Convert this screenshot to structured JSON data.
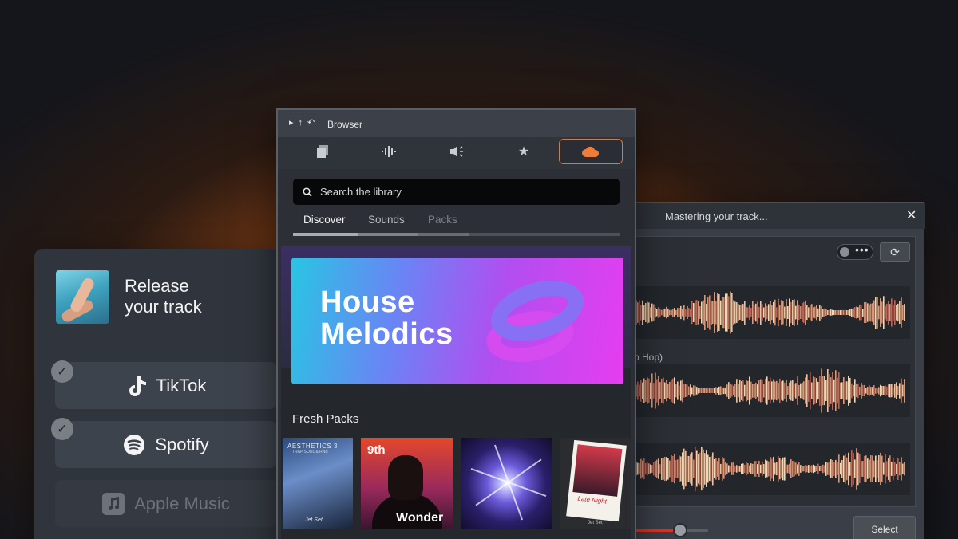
{
  "release": {
    "title_line1": "Release",
    "title_line2": "your track",
    "platforms": [
      {
        "label": "TikTok",
        "checked": true
      },
      {
        "label": "Spotify",
        "checked": true
      },
      {
        "label": "Apple Music",
        "checked": false
      }
    ]
  },
  "browser": {
    "title": "Browser",
    "toolbar_icons": [
      "files-icon",
      "waveform-icon",
      "speaker-icon",
      "star-icon",
      "cloud-icon"
    ],
    "active_toolbar_icon": "cloud-icon",
    "accent_color": "#f07c3b",
    "search_placeholder": "Search the library",
    "tabs": [
      {
        "label": "Discover",
        "active": true
      },
      {
        "label": "Sounds",
        "active": false
      },
      {
        "label": "Packs",
        "active": false
      }
    ],
    "hero": {
      "line1": "House",
      "line2": "Melodics"
    },
    "fresh_packs_title": "Fresh Packs",
    "packs": [
      {
        "line1": "AESTHETICS 3",
        "line2": "TRAP SOUL & RNB",
        "signature": "Jet Set"
      },
      {
        "line1": "9th",
        "line2": "Wonder"
      },
      {
        "line1": ""
      },
      {
        "caption": "Late Night",
        "signature": "Jet Set"
      }
    ]
  },
  "mastering": {
    "title": "Mastering your track...",
    "genre_fragment": "p Hop)",
    "select_label": "Select",
    "toggle_dots": "•••"
  }
}
